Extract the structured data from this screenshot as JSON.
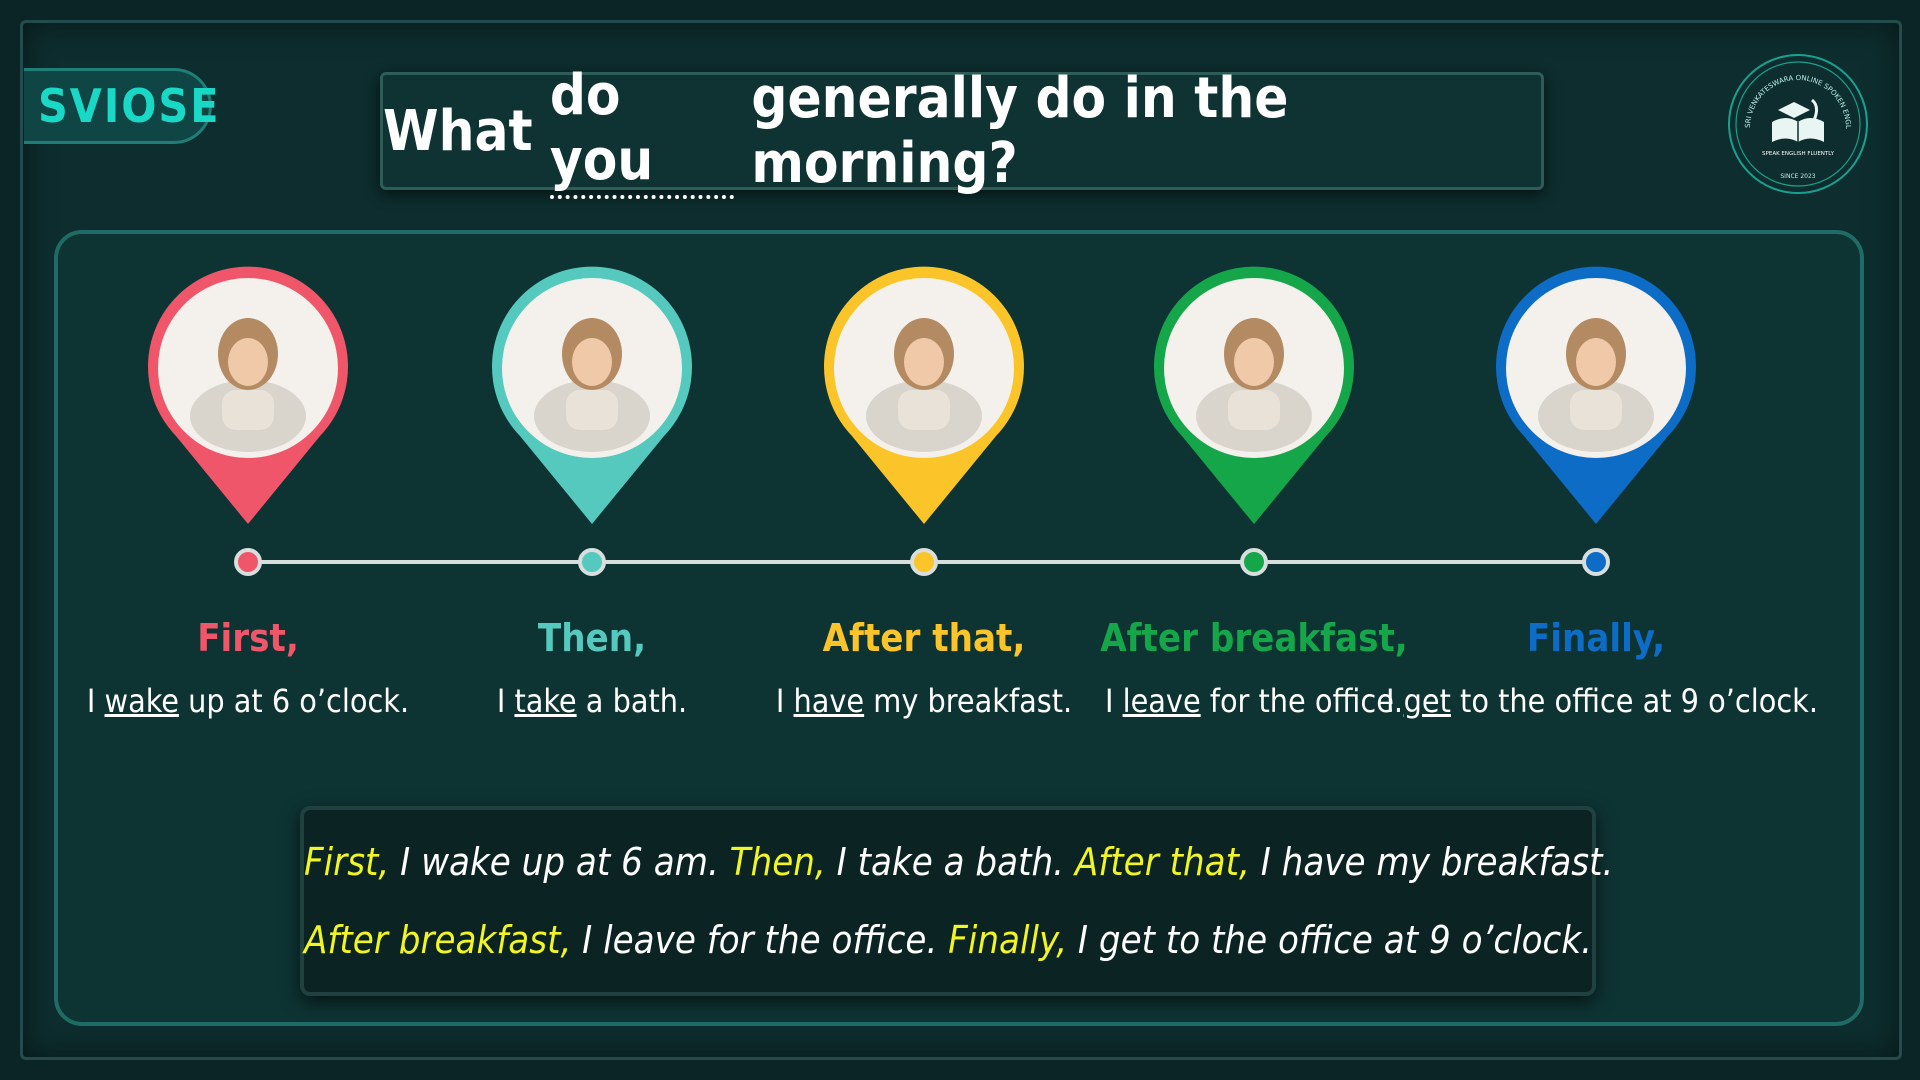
{
  "brand": {
    "text": "SVIOSE"
  },
  "question": {
    "part1": "What",
    "part2": "do you",
    "part3": "generally do in the morning?"
  },
  "seal": {
    "ring_text": "SRI VENKATESWARA ONLINE SPOKEN ENGLISH SCHOOL",
    "tagline": "SPEAK ENGLISH FLUENTLY",
    "since": "SINCE 2023",
    "icon": "graduation-cap-book-quill-icon"
  },
  "steps": [
    {
      "color": "#f0566a",
      "image": "woman-waking-in-bed",
      "label": "First,",
      "pre": "I ",
      "verb": "wake",
      "post": " up at 6 o’clock."
    },
    {
      "color": "#56c9be",
      "image": "woman-in-bathtub",
      "label": "Then,",
      "pre": "I ",
      "verb": "take",
      "post": " a bath."
    },
    {
      "color": "#fbc52a",
      "image": "woman-eating-breakfast",
      "label": "After that,",
      "pre": "I ",
      "verb": "have",
      "post": " my breakfast."
    },
    {
      "color": "#16a64a",
      "image": "woman-leaving-home",
      "label": "After breakfast,",
      "pre": "I ",
      "verb": "leave",
      "post": " for the office."
    },
    {
      "color": "#0d6cc6",
      "image": "woman-arriving-office",
      "label": "Finally,",
      "pre": "I ",
      "verb": "get",
      "post": " to the office at 9 o’clock."
    }
  ],
  "summary": {
    "line1": [
      {
        "t": "First,",
        "hl": true
      },
      {
        "t": " I wake up at 6 am. ",
        "hl": false
      },
      {
        "t": "Then,",
        "hl": true
      },
      {
        "t": " I take a bath. ",
        "hl": false
      },
      {
        "t": "After that,",
        "hl": true
      },
      {
        "t": " I have my breakfast.",
        "hl": false
      }
    ],
    "line2": [
      {
        "t": "After breakfast,",
        "hl": true
      },
      {
        "t": " I leave for the office. ",
        "hl": false
      },
      {
        "t": "Finally,",
        "hl": true
      },
      {
        "t": " I get to the office at 9 o’clock.",
        "hl": false
      }
    ]
  },
  "colors": {
    "highlight": "#f1f524",
    "background": "#0d2d2e",
    "brand": "#19d9c6"
  }
}
